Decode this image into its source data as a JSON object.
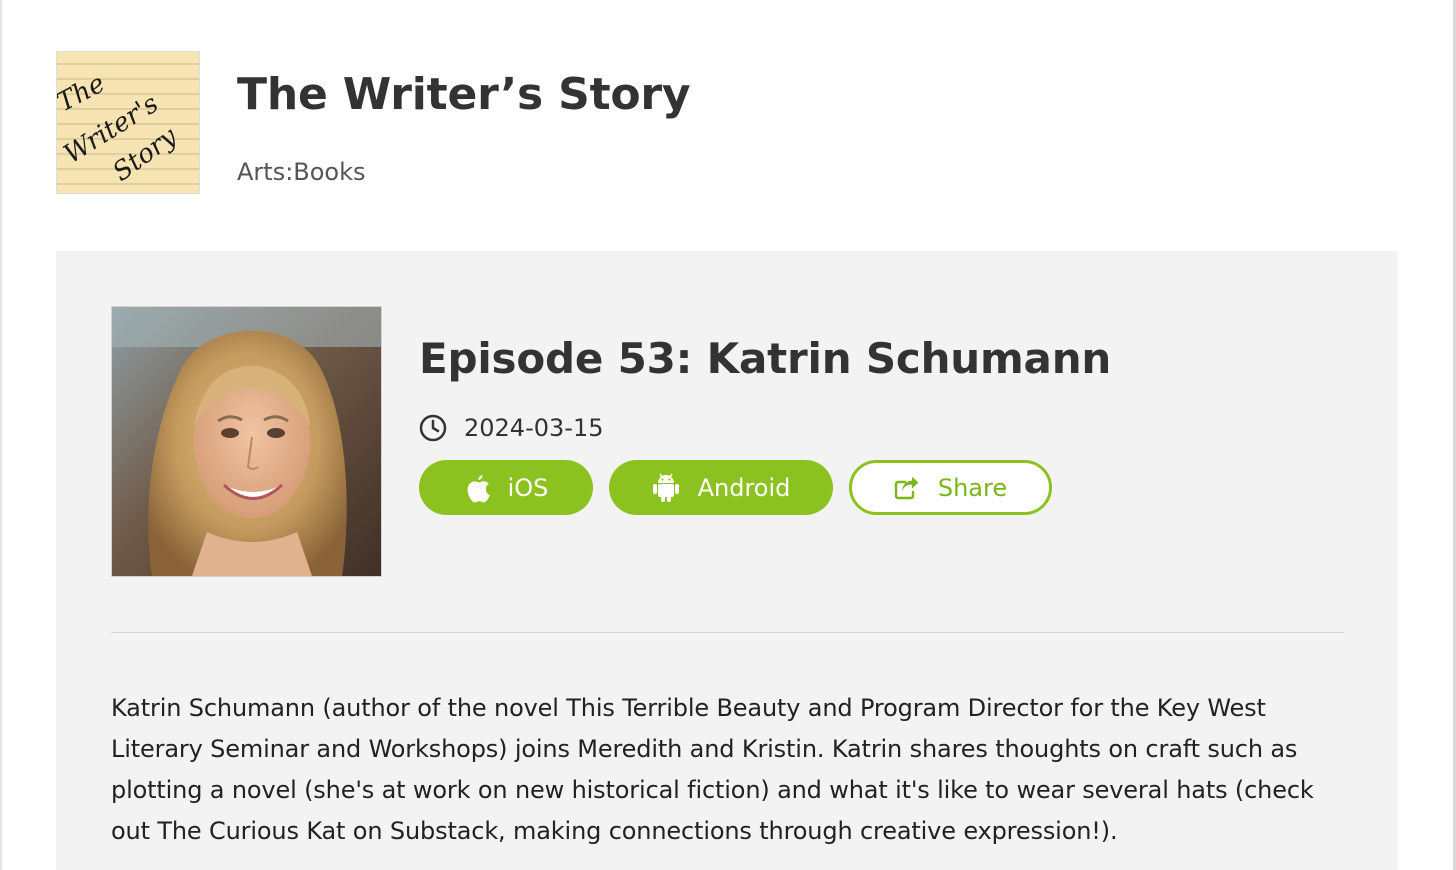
{
  "podcast": {
    "cover_icon": "notepad-cover-art",
    "cover_lines": [
      "The",
      "Writer's",
      "Story"
    ],
    "title": "The Writer’s Story",
    "category": "Arts:Books"
  },
  "episode": {
    "photo_icon": "guest-portrait",
    "title": "Episode 53: Katrin Schumann",
    "date_icon": "clock-icon",
    "date": "2024-03-15",
    "buttons": {
      "ios": {
        "label": "iOS",
        "icon": "apple-icon"
      },
      "android": {
        "label": "Android",
        "icon": "android-icon"
      },
      "share": {
        "label": "Share",
        "icon": "share-icon"
      }
    },
    "description": "Katrin Schumann (author of the novel This Terrible Beauty and Program Director for the Key West Literary Seminar and Workshops) joins Meredith and Kristin. Katrin shares thoughts on craft such as plotting a novel (she's at work on new historical fiction) and what it's like to wear several hats (check out The Curious Kat on Substack, making connections through creative expression!)."
  },
  "colors": {
    "accent": "#8cc21f",
    "panel_background": "#f3f3f3",
    "title_text": "#333333",
    "cover_paper": "#f7e6b8"
  }
}
